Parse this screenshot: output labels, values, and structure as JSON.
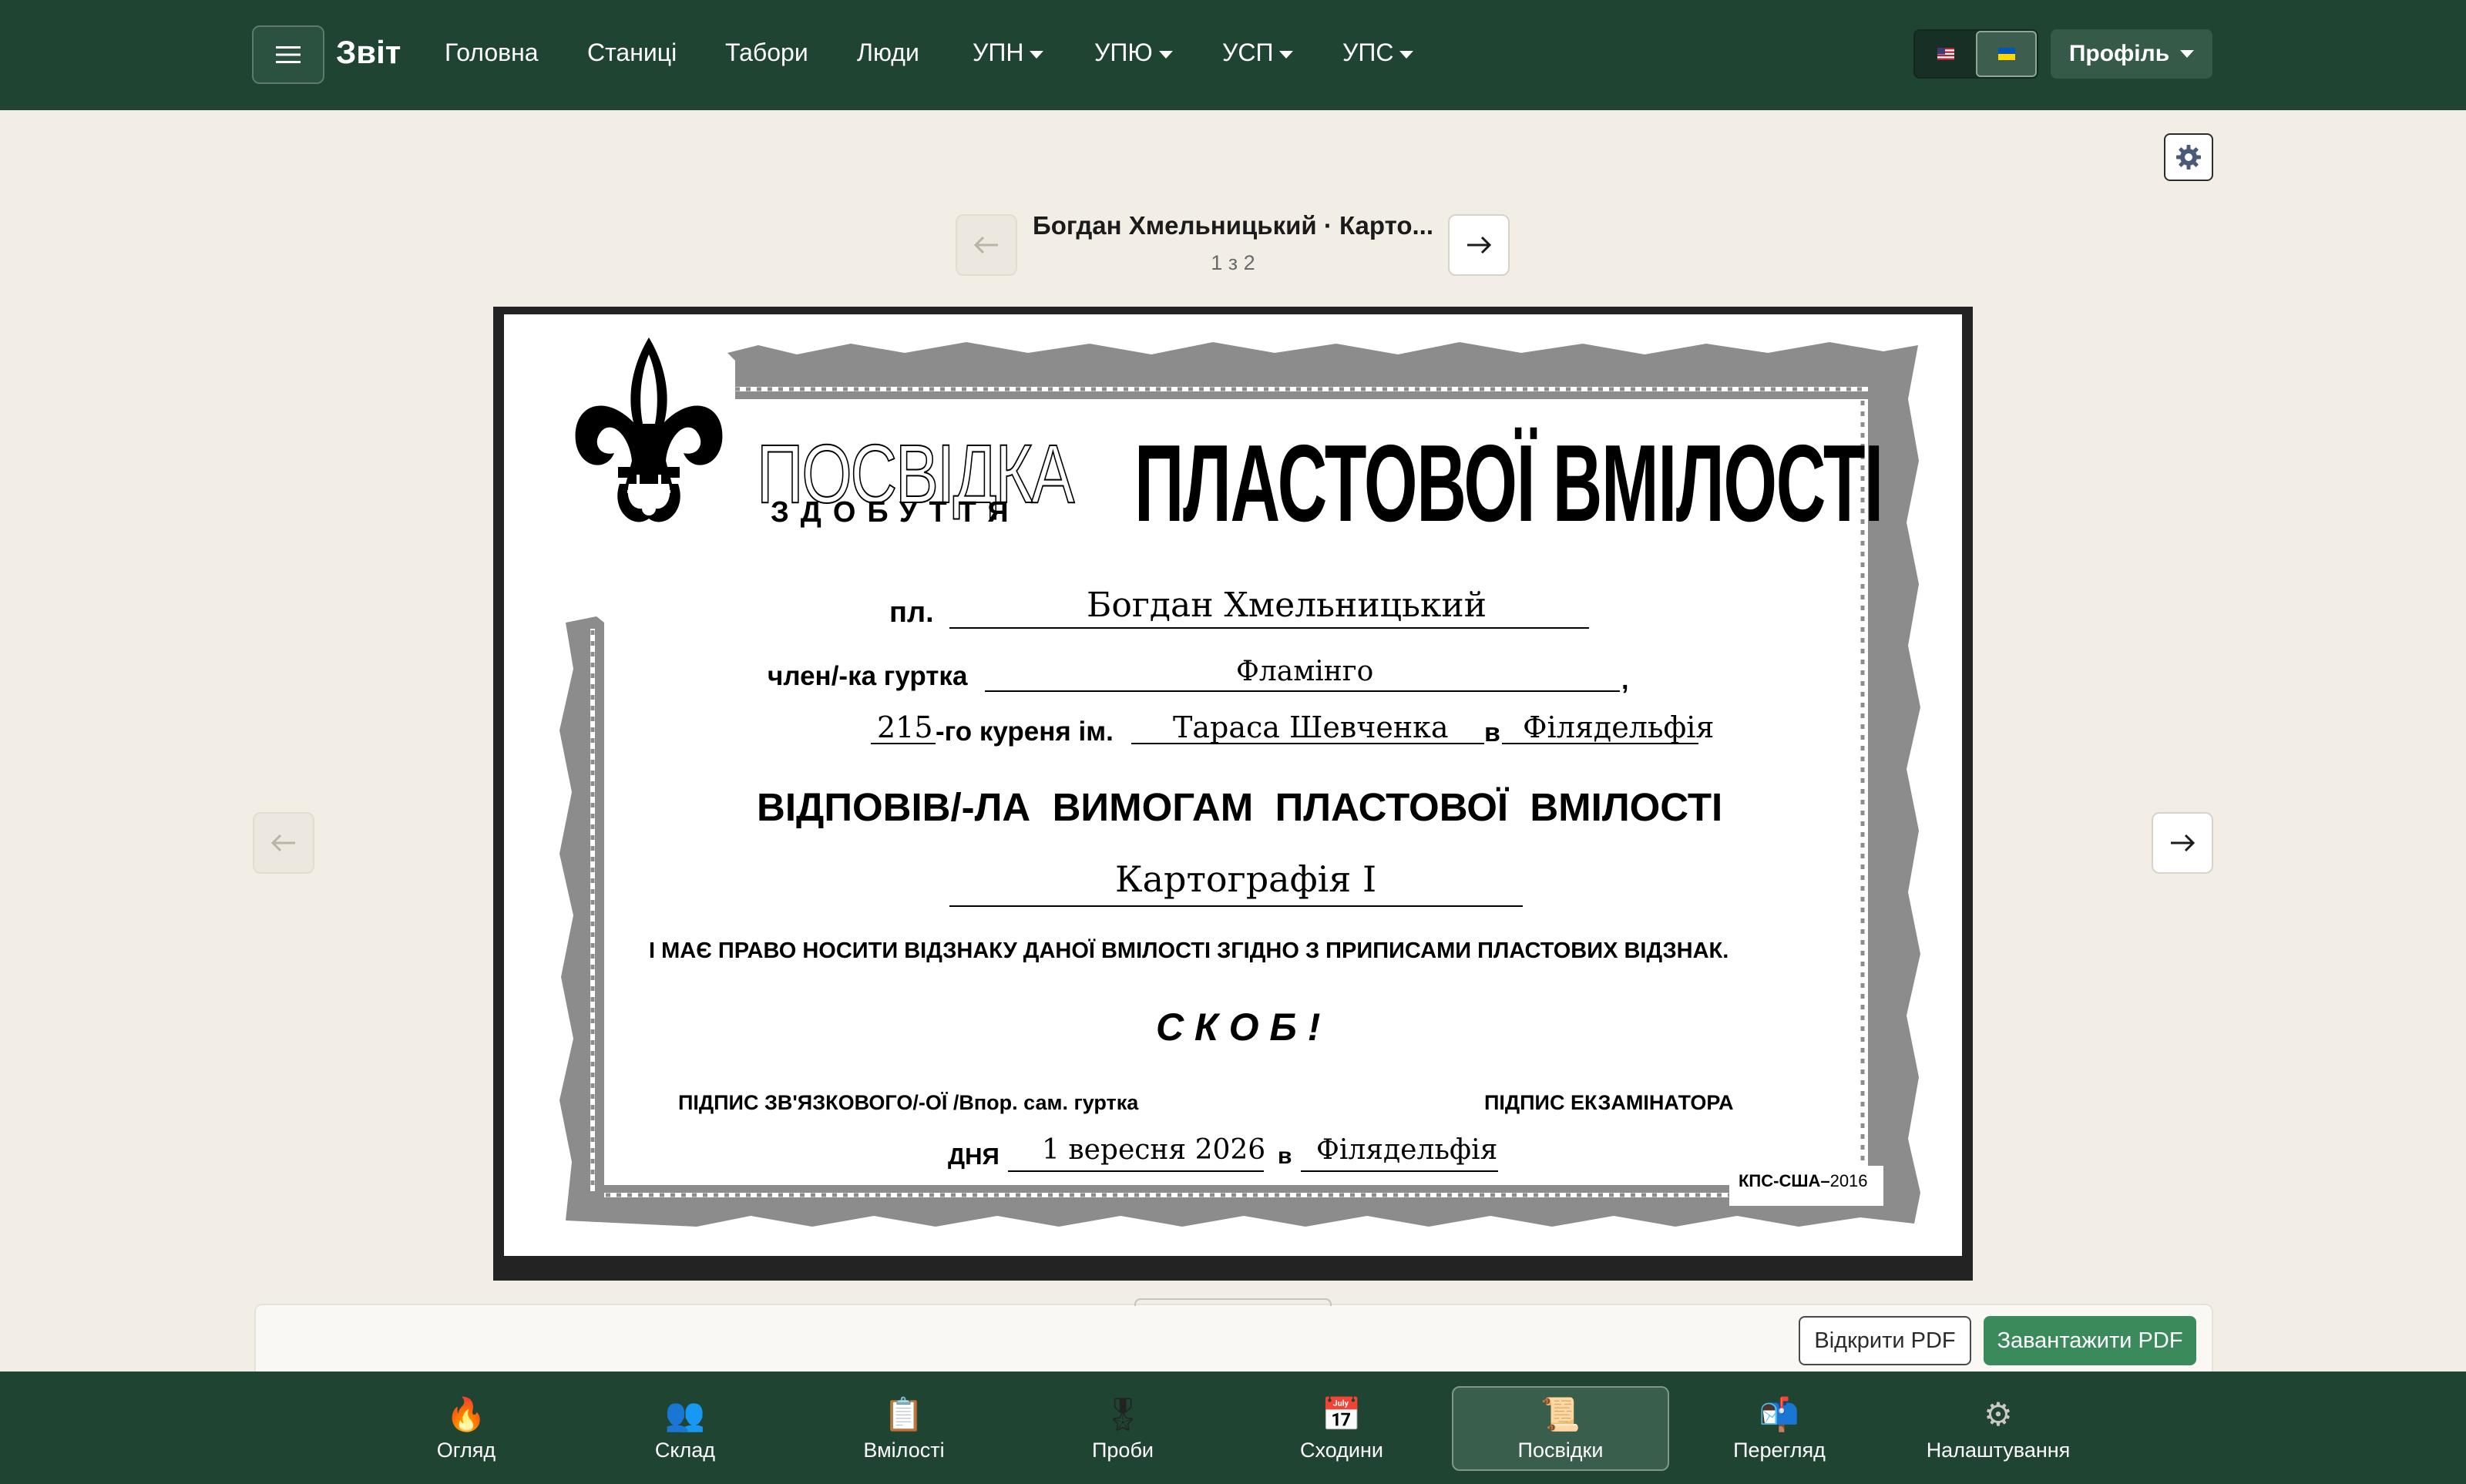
{
  "navbar": {
    "brand": "Звіт",
    "links": [
      {
        "label": "Головна",
        "dropdown": false
      },
      {
        "label": "Станиці",
        "dropdown": false
      },
      {
        "label": "Табори",
        "dropdown": false
      },
      {
        "label": "Люди",
        "dropdown": false
      },
      {
        "label": "УПН",
        "dropdown": true
      },
      {
        "label": "УПЮ",
        "dropdown": true
      },
      {
        "label": "УСП",
        "dropdown": true
      },
      {
        "label": "УПС",
        "dropdown": true
      }
    ],
    "language_flags": [
      "us-flag",
      "ua-flag"
    ],
    "active_language": "ua-flag",
    "profile_label": "Профіль"
  },
  "viewer": {
    "title": "Богдан Хмельницький · Карто...",
    "counter": "1 з 2"
  },
  "certificate": {
    "title_word": "ПОСВІДКА",
    "subtitle_word": "ЗДОБУТТЯ",
    "title_main": "ПЛАСТОВОЇ ВМІЛОСТІ",
    "pl_label": "пл.",
    "name": "Богдан Хмельницький",
    "member_label": "член/-ка гуртка",
    "group": "Фламінго",
    "kurin_number": "215",
    "kurin_label": "-го куреня ім.",
    "kurin_name": "Тараса Шевченка",
    "in_label": "в",
    "city": "Філядельфія",
    "met_requirements": "ВІДПОВІВ/-ЛА  ВИМОГАМ  ПЛАСТОВОЇ  ВМІЛОСТІ",
    "skill": "Картографія І",
    "right_text": "І МАЄ ПРАВО НОСИТИ ВІДЗНАКУ ДАНОЇ ВМІЛОСТІ ЗГІДНО З ПРИПИСАМИ ПЛАСТОВИХ ВІДЗНАК.",
    "motto": "С К О Б !",
    "signature_left": "ПІДПИС ЗВ'ЯЗКОВОГО/-ОЇ /Впор. сам. гуртка",
    "signature_right": "ПІДПИС ЕКЗАМІНАТОРА",
    "day_label": "ДНЯ",
    "date": "1 вересня 2026",
    "place_label": "в",
    "place": "Філядельфія",
    "form_code_bold": "КПС-США–",
    "form_code_year": "2016"
  },
  "actions": {
    "open_pdf": "Відкрити PDF",
    "download_pdf": "Завантажити PDF"
  },
  "tabs": [
    {
      "label": "Огляд",
      "icon": "campfire-icon",
      "glyph": "🔥"
    },
    {
      "label": "Склад",
      "icon": "people-icon",
      "glyph": "👥"
    },
    {
      "label": "Вмілості",
      "icon": "clipboard-icon",
      "glyph": "📋"
    },
    {
      "label": "Проби",
      "icon": "medal-icon",
      "glyph": "🎖"
    },
    {
      "label": "Сходини",
      "icon": "calendar-icon",
      "glyph": "📅"
    },
    {
      "label": "Посвідки",
      "icon": "scroll-icon",
      "glyph": "📜"
    },
    {
      "label": "Перегляд",
      "icon": "mailbox-icon",
      "glyph": "📬"
    },
    {
      "label": "Налаштування",
      "icon": "gear-icon",
      "glyph": "⚙"
    }
  ],
  "active_tab": "Посвідки",
  "colors": {
    "nav_green": "#1f4532",
    "page_bg": "#f2eee6",
    "download_green": "#3b8a5c",
    "certificate_border_gray": "#8a8a8a"
  }
}
